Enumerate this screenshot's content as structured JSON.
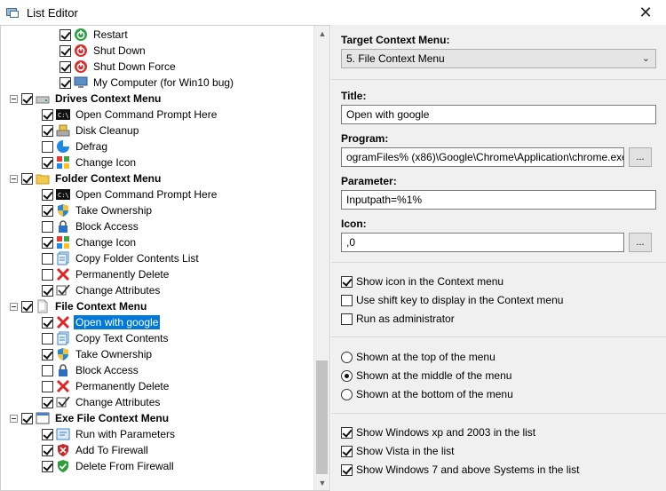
{
  "window": {
    "title": "List Editor"
  },
  "tree": {
    "rows": [
      {
        "label": "Restart",
        "icon": "power-green-icon",
        "checked": true,
        "level": 2
      },
      {
        "label": "Shut Down",
        "icon": "power-red-icon",
        "checked": true,
        "level": 2
      },
      {
        "label": "Shut Down Force",
        "icon": "power-red-icon",
        "checked": true,
        "level": 2
      },
      {
        "label": "My Computer (for Win10 bug)",
        "icon": "computer-icon",
        "checked": true,
        "level": 2
      },
      {
        "label": "Drives Context Menu",
        "icon": "drive-icon",
        "checked": true,
        "level": 0,
        "header": true
      },
      {
        "label": "Open Command Prompt Here",
        "icon": "cmd-icon",
        "checked": true,
        "level": 1
      },
      {
        "label": "Disk Cleanup",
        "icon": "disk-cleanup-icon",
        "checked": true,
        "level": 1
      },
      {
        "label": "Defrag",
        "icon": "defrag-icon",
        "checked": false,
        "level": 1
      },
      {
        "label": "Change Icon",
        "icon": "change-icon-icon",
        "checked": true,
        "level": 1
      },
      {
        "label": "Folder Context Menu",
        "icon": "folder-icon",
        "checked": true,
        "level": 0,
        "header": true
      },
      {
        "label": "Open Command Prompt Here",
        "icon": "cmd-icon",
        "checked": true,
        "level": 1
      },
      {
        "label": "Take Ownership",
        "icon": "shield-icon",
        "checked": true,
        "level": 1
      },
      {
        "label": "Block Access",
        "icon": "lock-icon",
        "checked": false,
        "level": 1
      },
      {
        "label": "Change Icon",
        "icon": "change-icon-icon",
        "checked": true,
        "level": 1
      },
      {
        "label": "Copy Folder Contents List",
        "icon": "copy-list-icon",
        "checked": false,
        "level": 1
      },
      {
        "label": "Permanently Delete",
        "icon": "delete-x-icon",
        "checked": false,
        "level": 1
      },
      {
        "label": "Change Attributes",
        "icon": "attributes-check-icon",
        "checked": true,
        "level": 1
      },
      {
        "label": "File Context Menu",
        "icon": "file-icon",
        "checked": true,
        "level": 0,
        "header": true
      },
      {
        "label": "Open with google",
        "icon": "delete-x-icon",
        "checked": true,
        "level": 1,
        "selected": true
      },
      {
        "label": "Copy Text Contents",
        "icon": "copy-list-icon",
        "checked": false,
        "level": 1
      },
      {
        "label": "Take Ownership",
        "icon": "shield-icon",
        "checked": true,
        "level": 1
      },
      {
        "label": "Block Access",
        "icon": "lock-icon",
        "checked": false,
        "level": 1
      },
      {
        "label": "Permanently Delete",
        "icon": "delete-x-icon",
        "checked": false,
        "level": 1
      },
      {
        "label": "Change Attributes",
        "icon": "attributes-check-icon",
        "checked": true,
        "level": 1
      },
      {
        "label": "Exe File Context Menu",
        "icon": "exe-window-icon",
        "checked": true,
        "level": 0,
        "header": true
      },
      {
        "label": "Run with Parameters",
        "icon": "run-params-icon",
        "checked": true,
        "level": 1
      },
      {
        "label": "Add To Firewall",
        "icon": "firewall-red-icon",
        "checked": true,
        "level": 1
      },
      {
        "label": "Delete From Firewall",
        "icon": "firewall-green-icon",
        "checked": true,
        "level": 1
      }
    ]
  },
  "form": {
    "target_label": "Target Context Menu:",
    "target_value": "5. File Context Menu",
    "title_label": "Title:",
    "title_value": "Open with google",
    "program_label": "Program:",
    "program_value": "ogramFiles% (x86)\\Google\\Chrome\\Application\\chrome.exe",
    "parameter_label": "Parameter:",
    "parameter_value": "Inputpath=%1%",
    "icon_label": "Icon:",
    "icon_value": ",0",
    "browse_label": "...",
    "options": [
      {
        "label": "Show icon in the Context menu",
        "checked": true
      },
      {
        "label": "Use shift key to display in the Context menu",
        "checked": false
      },
      {
        "label": "Run as administrator",
        "checked": false
      }
    ],
    "positions": [
      {
        "label": "Shown at the top of the menu",
        "checked": false
      },
      {
        "label": "Shown at the middle of the menu",
        "checked": true
      },
      {
        "label": "Shown at the bottom of the menu",
        "checked": false
      }
    ],
    "systems": [
      {
        "label": "Show Windows xp  and 2003 in the list",
        "checked": true
      },
      {
        "label": "Show Vista in the list",
        "checked": true
      },
      {
        "label": "Show Windows 7 and above Systems in the list",
        "checked": true
      }
    ]
  },
  "colors": {
    "selection": "#0078d7",
    "panel": "#f0f0f0"
  }
}
